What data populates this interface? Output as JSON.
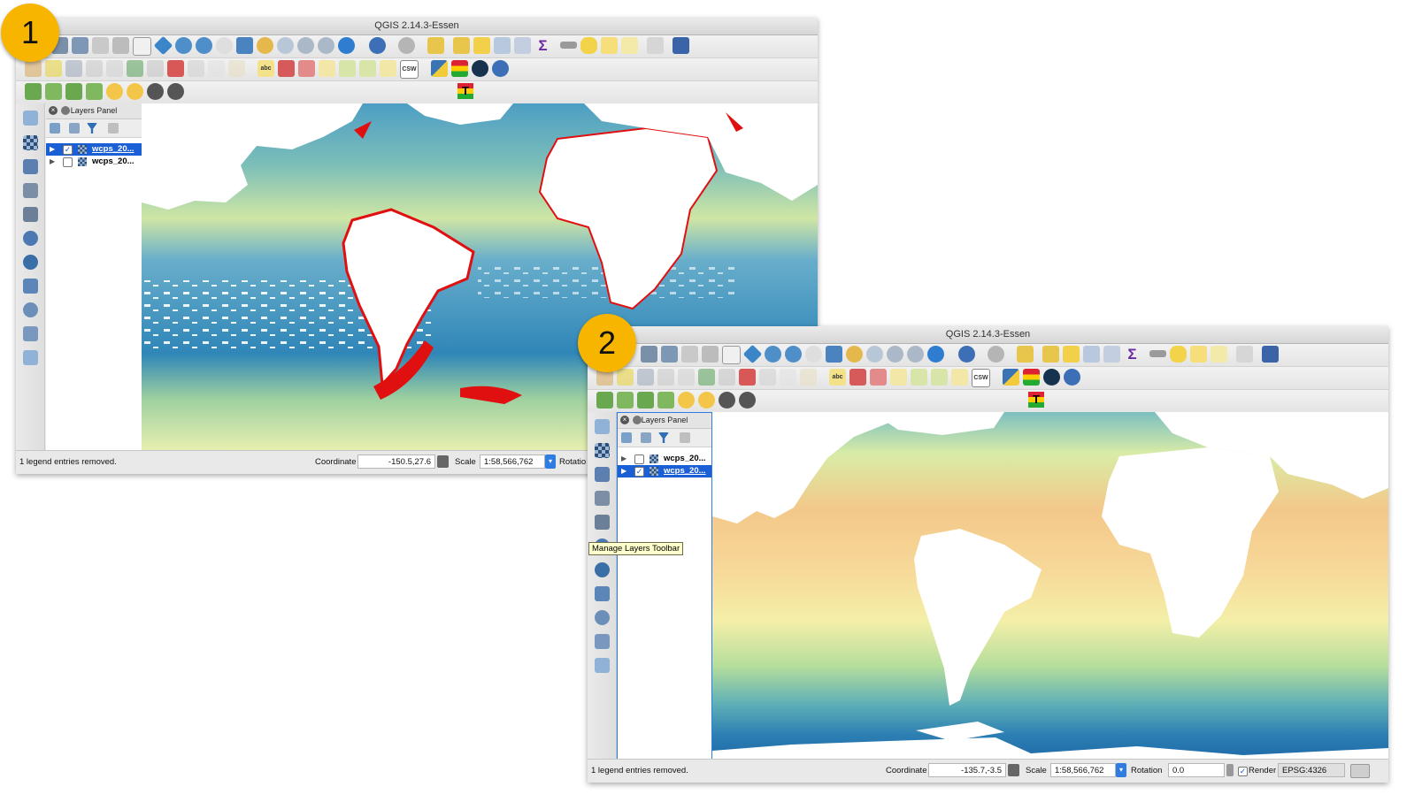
{
  "windows": [
    {
      "title": "QGIS 2.14.3-Essen",
      "layers_panel": {
        "title": "Layers Panel",
        "layers": [
          {
            "name": "wcps_20...",
            "checked": true,
            "selected": true
          },
          {
            "name": "wcps_20...",
            "checked": false,
            "selected": false
          }
        ]
      },
      "status": {
        "message": "1 legend entries removed.",
        "coordinate_label": "Coordinate",
        "coordinate_value": "-150.5,27.6",
        "scale_label": "Scale",
        "scale_value": "1:58,566,762",
        "rotation_label": "Rotatio"
      },
      "map_style": "chlorophyll"
    },
    {
      "title": "QGIS 2.14.3-Essen",
      "layers_panel": {
        "title": "Layers Panel",
        "layers": [
          {
            "name": "wcps_20...",
            "checked": false,
            "selected": false
          },
          {
            "name": "wcps_20...",
            "checked": true,
            "selected": true
          }
        ]
      },
      "status": {
        "message": "1 legend entries removed.",
        "coordinate_label": "Coordinate",
        "coordinate_value": "-135.7,-3.5",
        "scale_label": "Scale",
        "scale_value": "1:58,566,762",
        "rotation_label": "Rotation",
        "rotation_value": "0.0",
        "render_label": "Render",
        "crs_label": "EPSG:4326"
      },
      "map_style": "temperature"
    }
  ],
  "badges": [
    "1",
    "2"
  ],
  "tooltip": "Manage Layers Toolbar",
  "toolbar_glyphs": {
    "sigma": "Σ",
    "csw": "CSW",
    "abc": "abc",
    "checkmark": "✓",
    "expand_arrow": "▶"
  },
  "colors": {
    "selection": "#1b5fd6",
    "badge": "#f7b500",
    "coast_highlight": "#e01010",
    "ocean_blue": "#2f86b8",
    "ocean_green": "#9ed0a0",
    "ocean_yellow": "#eef0a6",
    "ocean_orange": "#f4c587"
  }
}
